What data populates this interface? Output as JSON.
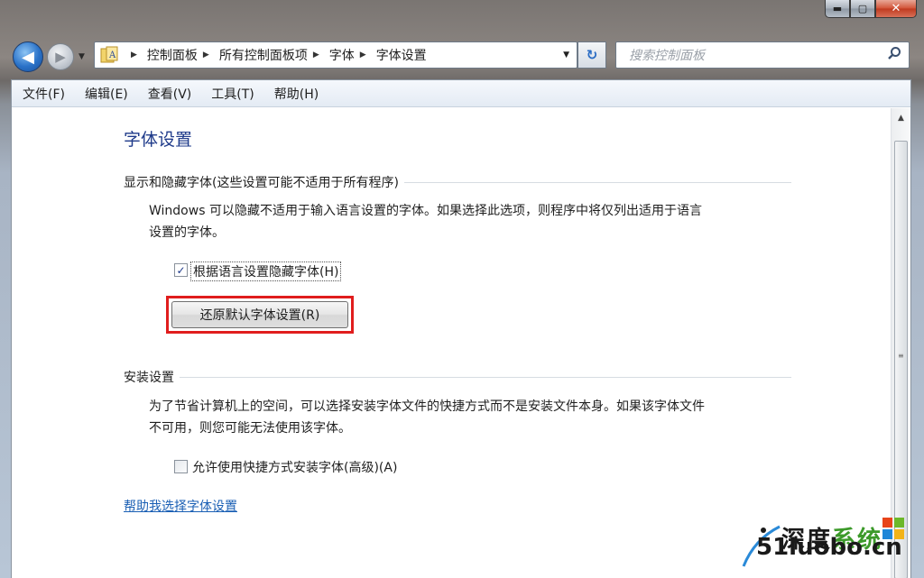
{
  "window": {
    "caption": {
      "minimize": "▬",
      "maximize": "▢",
      "close": "✕"
    }
  },
  "nav": {
    "back_glyph": "◀",
    "forward_glyph": "▶",
    "dropdown_glyph": "▼",
    "breadcrumbs": [
      "控制面板",
      "所有控制面板项",
      "字体",
      "字体设置"
    ],
    "refresh_glyph": "↻",
    "search_placeholder": "搜索控制面板",
    "search_icon": "search-icon"
  },
  "menubar": {
    "items": [
      "文件(F)",
      "编辑(E)",
      "查看(V)",
      "工具(T)",
      "帮助(H)"
    ]
  },
  "content": {
    "title": "字体设置",
    "section1": {
      "label": "显示和隐藏字体(这些设置可能不适用于所有程序)",
      "description_line1": "Windows 可以隐藏不适用于输入语言设置的字体。如果选择此选项，则程序中将仅列出适用于语言",
      "description_line2": "设置的字体。",
      "checkbox_label": "根据语言设置隐藏字体(H)",
      "checkbox_checked": true,
      "restore_button": "还原默认字体设置(R)"
    },
    "section2": {
      "label": "安装设置",
      "description_line1": "为了节省计算机上的空间，可以选择安装字体文件的快捷方式而不是安装文件本身。如果该字体文件",
      "description_line2": "不可用，则您可能无法使用该字体。",
      "checkbox_label": "允许使用快捷方式安装字体(高级)(A)",
      "checkbox_checked": false
    },
    "help_link": "帮助我选择字体设置"
  },
  "watermark": {
    "cn_text": "深度",
    "cn_accent": "系统",
    "site": "51luobo.cn"
  },
  "colors": {
    "highlight_frame": "#e01d1d",
    "title_blue": "#1e3a8a",
    "link_blue": "#1a5fb4"
  }
}
